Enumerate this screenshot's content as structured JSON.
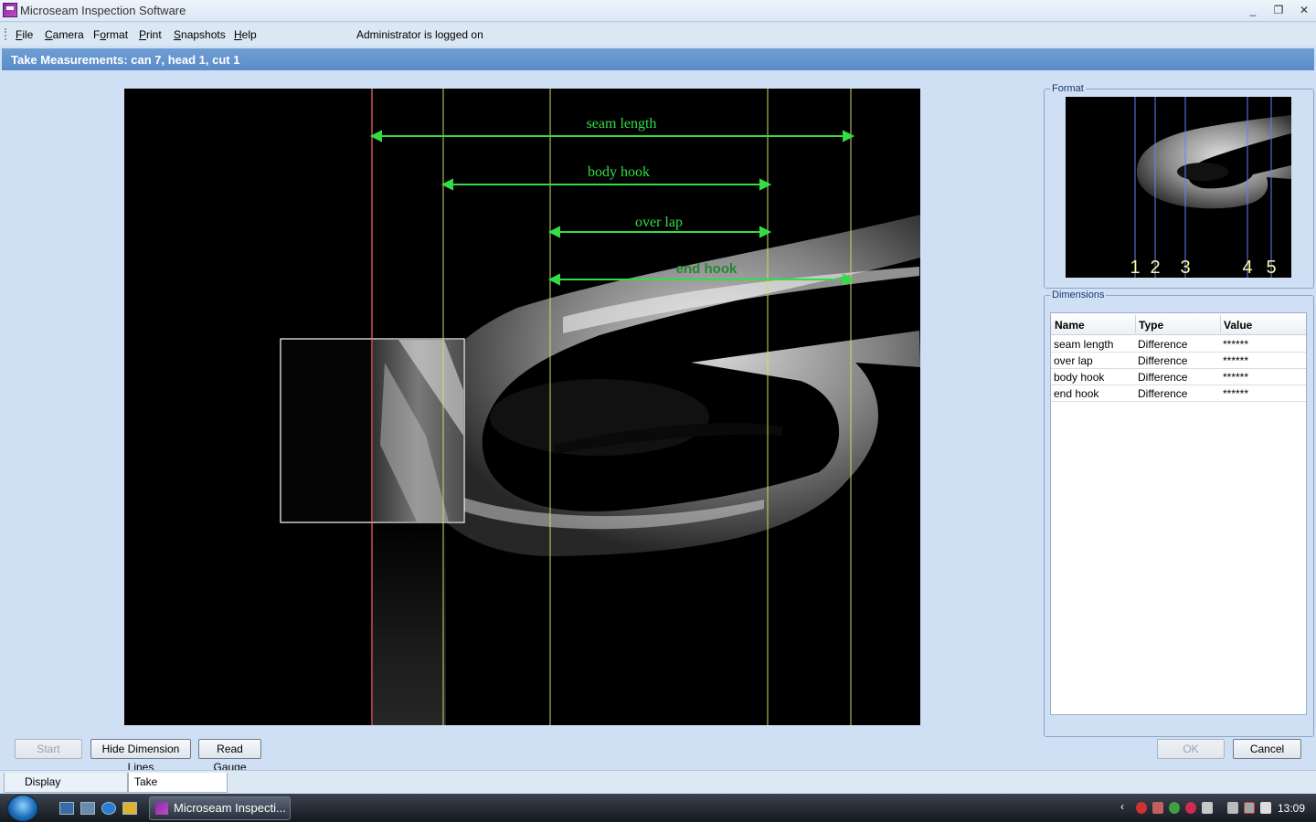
{
  "window": {
    "title": "Microseam Inspection Software",
    "minimize": "_",
    "maximize": "❐",
    "close": "✕"
  },
  "menu": {
    "items": [
      {
        "label": "File",
        "accel": "F"
      },
      {
        "label": "Camera",
        "accel": "C"
      },
      {
        "label": "Format",
        "accel": "o"
      },
      {
        "label": "Print",
        "accel": "P"
      },
      {
        "label": "Snapshots",
        "accel": "S"
      },
      {
        "label": "Help",
        "accel": "H"
      }
    ],
    "status": "Administrator is logged on"
  },
  "header": {
    "title": "Take Measurements: can 7, head 1, cut 1"
  },
  "measurement_image": {
    "labels": {
      "seam_length": "seam length",
      "body_hook": "body hook",
      "over_lap": "over lap",
      "end_hook": "end hook"
    },
    "line_color": "#33dd44",
    "ref_line_color": "#ff6666",
    "guide_line_color": "#d8d860"
  },
  "format_panel": {
    "title": "Format",
    "markers": [
      "1",
      "2",
      "3",
      "4",
      "5"
    ]
  },
  "dimensions_panel": {
    "title": "Dimensions",
    "columns": [
      "Name",
      "Type",
      "Value"
    ],
    "rows": [
      {
        "name": "seam length",
        "type": "Difference",
        "value": "******"
      },
      {
        "name": "over lap",
        "type": "Difference",
        "value": "******"
      },
      {
        "name": "body hook",
        "type": "Difference",
        "value": "******"
      },
      {
        "name": "end hook",
        "type": "Difference",
        "value": "******"
      }
    ]
  },
  "buttons": {
    "start": "Start",
    "hide_dimension_lines": "Hide Dimension Lines",
    "read_gauge": "Read Gauge",
    "ok": "OK",
    "cancel": "Cancel"
  },
  "tabs": {
    "display": "Display Measurements",
    "take": "Take Measurements"
  },
  "taskbar": {
    "task_label": "Microseam Inspecti...",
    "clock": "13:09"
  }
}
